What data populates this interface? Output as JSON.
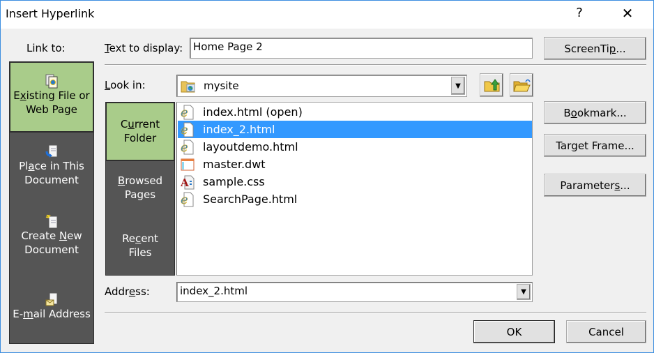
{
  "window": {
    "title": "Insert Hyperlink",
    "help_label": "?",
    "close_label": "✕"
  },
  "link_to": {
    "label": "Link to:",
    "items": [
      {
        "label_pre": "E",
        "label_u": "x",
        "label_post": "isting File or",
        "label2": "Web Page",
        "icon": "existing-file-icon",
        "active": true
      },
      {
        "label_pre": "Pl",
        "label_u": "a",
        "label_post": "ce in This",
        "label2": "Document",
        "icon": "place-in-document-icon",
        "active": false
      },
      {
        "label_pre": "Create ",
        "label_u": "N",
        "label_post": "ew",
        "label2": "Document",
        "icon": "new-document-icon",
        "active": false
      },
      {
        "label_pre": "E-",
        "label_u": "m",
        "label_post": "ail Address",
        "label2": "",
        "icon": "email-icon",
        "active": false
      }
    ]
  },
  "text_to_display": {
    "label_u": "T",
    "label_rest": "ext to display:",
    "value": "Home Page 2"
  },
  "screentip_button": {
    "label_pre": "ScreenTi",
    "label_u": "p",
    "label_post": "..."
  },
  "look_in": {
    "label_u": "L",
    "label_rest": "ook in:",
    "value": "mysite",
    "icon": "web-folder-icon",
    "up_folder_icon": "up-folder-icon",
    "browse_folder_icon": "browse-folder-icon"
  },
  "sub_nav": {
    "items": [
      {
        "label_pre": "C",
        "label_u": "u",
        "label_post": "rrent",
        "label2": "Folder",
        "active": true
      },
      {
        "label_pre": "",
        "label_u": "B",
        "label_post": "rowsed",
        "label2": "Pages",
        "active": false
      },
      {
        "label_pre": "Re",
        "label_u": "c",
        "label_post": "ent",
        "label2": "Files",
        "active": false
      }
    ]
  },
  "files": [
    {
      "name": "index.html (open)",
      "icon": "ie-html-icon",
      "selected": false
    },
    {
      "name": "index_2.html",
      "icon": "ie-html-icon",
      "selected": true
    },
    {
      "name": "layoutdemo.html",
      "icon": "ie-html-icon",
      "selected": false
    },
    {
      "name": "master.dwt",
      "icon": "template-icon",
      "selected": false
    },
    {
      "name": "sample.css",
      "icon": "css-icon",
      "selected": false
    },
    {
      "name": "SearchPage.html",
      "icon": "ie-html-icon",
      "selected": false
    }
  ],
  "right_buttons": {
    "bookmark": {
      "label_pre": "B",
      "label_u": "o",
      "label_post": "okmark..."
    },
    "target_frame": {
      "label_pre": "Tar",
      "label_u": "g",
      "label_post": "et Frame..."
    },
    "parameters": {
      "label_pre": "Parameter",
      "label_u": "s",
      "label_post": "..."
    }
  },
  "address": {
    "label_pre": "Addr",
    "label_u": "e",
    "label_post": "ss:",
    "value": "index_2.html"
  },
  "footer": {
    "ok_label": "OK",
    "cancel_label": "Cancel"
  },
  "colors": {
    "active_nav": "#a9cc8a",
    "nav_bg": "#555555",
    "selection": "#3399ff",
    "window_border": "#3c8ee0"
  }
}
